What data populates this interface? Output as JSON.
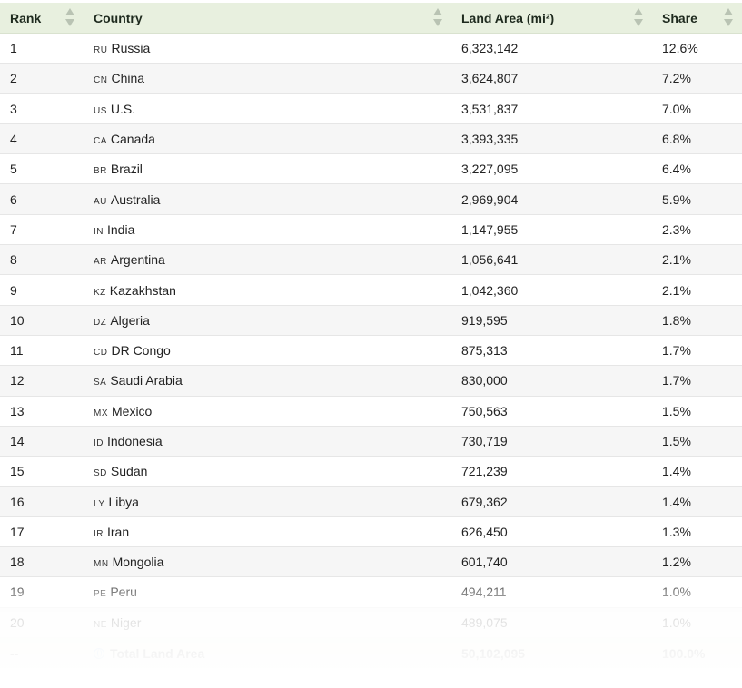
{
  "table": {
    "headers": {
      "rank": "Rank",
      "country": "Country",
      "area": "Land Area (mi²)",
      "share": "Share"
    },
    "rows": [
      {
        "rank": "1",
        "code": "RU",
        "country": "Russia",
        "area": "6,323,142",
        "share": "12.6%"
      },
      {
        "rank": "2",
        "code": "CN",
        "country": "China",
        "area": "3,624,807",
        "share": "7.2%"
      },
      {
        "rank": "3",
        "code": "US",
        "country": "U.S.",
        "area": "3,531,837",
        "share": "7.0%"
      },
      {
        "rank": "4",
        "code": "CA",
        "country": "Canada",
        "area": "3,393,335",
        "share": "6.8%"
      },
      {
        "rank": "5",
        "code": "BR",
        "country": "Brazil",
        "area": "3,227,095",
        "share": "6.4%"
      },
      {
        "rank": "6",
        "code": "AU",
        "country": "Australia",
        "area": "2,969,904",
        "share": "5.9%"
      },
      {
        "rank": "7",
        "code": "IN",
        "country": "India",
        "area": "1,147,955",
        "share": "2.3%"
      },
      {
        "rank": "8",
        "code": "AR",
        "country": "Argentina",
        "area": "1,056,641",
        "share": "2.1%"
      },
      {
        "rank": "9",
        "code": "KZ",
        "country": "Kazakhstan",
        "area": "1,042,360",
        "share": "2.1%"
      },
      {
        "rank": "10",
        "code": "DZ",
        "country": "Algeria",
        "area": "919,595",
        "share": "1.8%"
      },
      {
        "rank": "11",
        "code": "CD",
        "country": "DR Congo",
        "area": "875,313",
        "share": "1.7%"
      },
      {
        "rank": "12",
        "code": "SA",
        "country": "Saudi Arabia",
        "area": "830,000",
        "share": "1.7%"
      },
      {
        "rank": "13",
        "code": "MX",
        "country": "Mexico",
        "area": "750,563",
        "share": "1.5%"
      },
      {
        "rank": "14",
        "code": "ID",
        "country": "Indonesia",
        "area": "730,719",
        "share": "1.5%"
      },
      {
        "rank": "15",
        "code": "SD",
        "country": "Sudan",
        "area": "721,239",
        "share": "1.4%"
      },
      {
        "rank": "16",
        "code": "LY",
        "country": "Libya",
        "area": "679,362",
        "share": "1.4%"
      },
      {
        "rank": "17",
        "code": "IR",
        "country": "Iran",
        "area": "626,450",
        "share": "1.3%"
      },
      {
        "rank": "18",
        "code": "MN",
        "country": "Mongolia",
        "area": "601,740",
        "share": "1.2%"
      },
      {
        "rank": "19",
        "code": "PE",
        "country": "Peru",
        "area": "494,211",
        "share": "1.0%"
      },
      {
        "rank": "20",
        "code": "NE",
        "country": "Niger",
        "area": "489,075",
        "share": "1.0%"
      }
    ],
    "total": {
      "rank": "--",
      "label": "Total Land Area",
      "area": "50,102,095",
      "share": "100.0%"
    }
  },
  "colors": {
    "header_bg": "#e8f0df",
    "row_alt_bg": "#f6f6f6",
    "sort_arrow": "#b9c3b3"
  },
  "icons": {
    "sort": "sort-arrows-icon",
    "total": "globe-icon"
  }
}
